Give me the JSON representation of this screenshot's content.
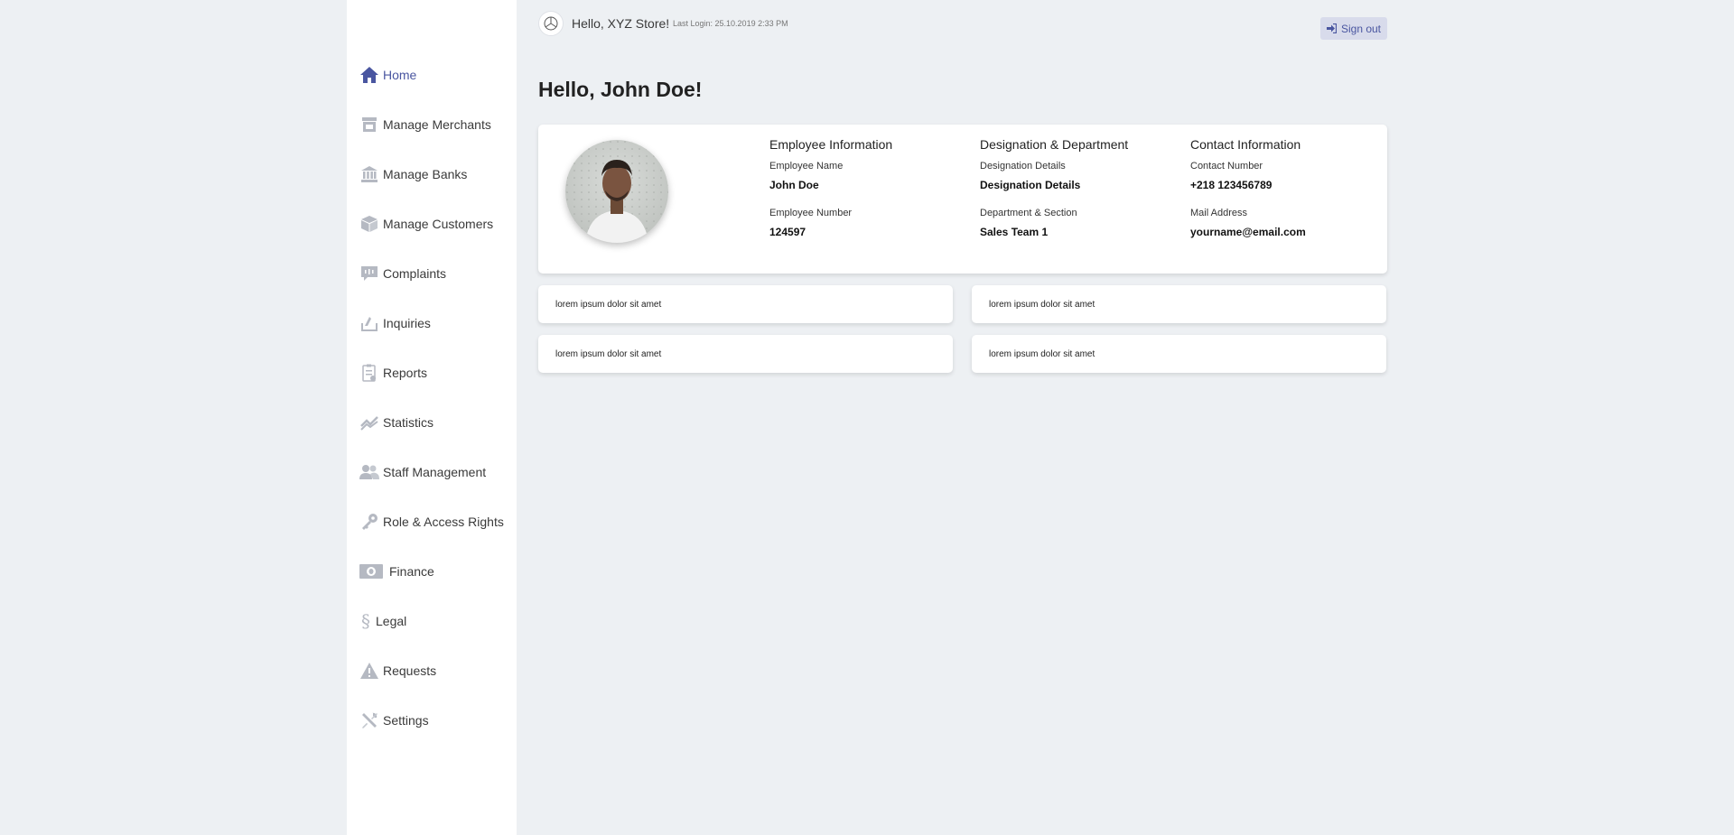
{
  "colors": {
    "accent": "#4a56a0",
    "icon_gray": "#b5b9c2",
    "background": "#edf0f3"
  },
  "sidebar": {
    "items": [
      {
        "label": "Home",
        "icon": "home-icon",
        "active": true
      },
      {
        "label": "Manage Merchants",
        "icon": "store-icon"
      },
      {
        "label": "Manage Banks",
        "icon": "bank-icon"
      },
      {
        "label": "Manage Customers",
        "icon": "customers-icon"
      },
      {
        "label": "Complaints",
        "icon": "complaint-icon"
      },
      {
        "label": "Inquiries",
        "icon": "inquiry-icon"
      },
      {
        "label": "Reports",
        "icon": "report-icon"
      },
      {
        "label": "Statistics",
        "icon": "statistics-icon"
      },
      {
        "label": "Staff Management",
        "icon": "staff-icon"
      },
      {
        "label": "Role & Access Rights",
        "icon": "key-icon"
      },
      {
        "label": "Finance",
        "icon": "money-icon"
      },
      {
        "label": "Legal",
        "icon": "section-icon"
      },
      {
        "label": "Requests",
        "icon": "warning-icon"
      },
      {
        "label": "Settings",
        "icon": "tools-icon"
      }
    ]
  },
  "topbar": {
    "greeting": "Hello, XYZ Store!",
    "last_login": "Last Login: 25.10.2019 2:33 PM",
    "signout_label": "Sign out"
  },
  "main": {
    "title": "Hello, John Doe!",
    "profile": {
      "columns": [
        {
          "heading": "Employee Information",
          "fields": [
            {
              "label": "Employee Name",
              "value": "John Doe"
            },
            {
              "label": "Employee Number",
              "value": "124597"
            }
          ]
        },
        {
          "heading": "Designation & Department",
          "fields": [
            {
              "label": "Designation Details",
              "value": "Designation Details"
            },
            {
              "label": "Department & Section",
              "value": "Sales Team 1"
            }
          ]
        },
        {
          "heading": "Contact Information",
          "fields": [
            {
              "label": "Contact Number",
              "value": "+218 123456789"
            },
            {
              "label": "Mail Address",
              "value": "yourname@email.com"
            }
          ]
        }
      ]
    },
    "cards": [
      "lorem ipsum dolor sit amet",
      "lorem ipsum dolor sit amet",
      "lorem ipsum dolor sit amet",
      "lorem ipsum dolor sit amet"
    ]
  }
}
